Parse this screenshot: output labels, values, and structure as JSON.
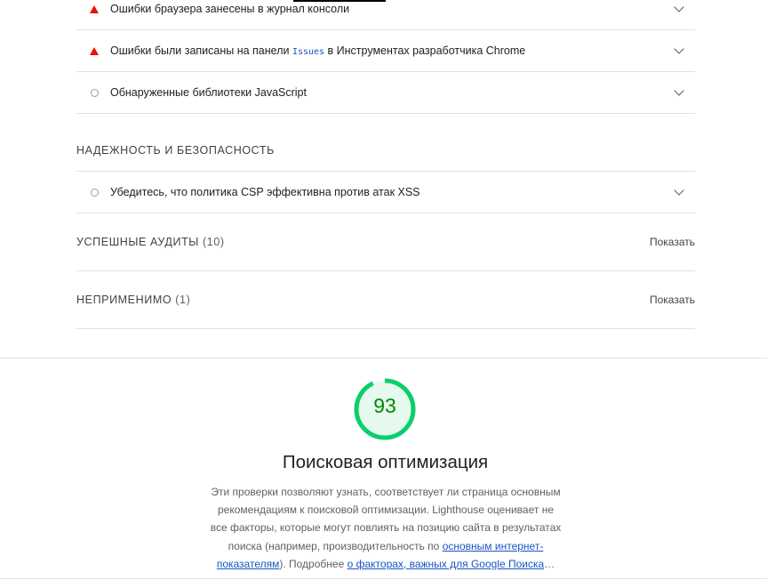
{
  "best_practices_audits": [
    {
      "type": "fail",
      "icon": "warning-triangle-icon",
      "title": "Ошибки браузера занесены в журнал консоли"
    },
    {
      "type": "fail",
      "icon": "warning-triangle-icon",
      "title_before": "Ошибки были записаны на панели ",
      "title_code": "Issues",
      "title_after": " в Инструментах разработчика Chrome"
    },
    {
      "type": "info",
      "icon": "neutral-circle-icon",
      "title": "Обнаруженные библиотеки JavaScript"
    }
  ],
  "trust_group": {
    "title": "НАДЕЖНОСТЬ И БЕЗОПАСНОСТЬ",
    "audits": [
      {
        "type": "info",
        "icon": "neutral-circle-icon",
        "title": "Убедитесь, что политика CSP эффективна против атак XSS"
      }
    ]
  },
  "passed_group": {
    "label": "УСПЕШНЫЕ АУДИТЫ",
    "count": "(10)",
    "show": "Показать"
  },
  "na_group": {
    "label": "НЕПРИМЕНИМО",
    "count": "(1)",
    "show": "Показать"
  },
  "seo_category": {
    "score": "93",
    "score_fraction": 0.93,
    "gauge_color": "#0cce6b",
    "score_text_color": "#008800",
    "title": "Поисковая оптимизация",
    "desc_line1": "Эти проверки позволяют узнать, соответствует ли страница основным",
    "desc_line2": "рекомендациям к поисковой оптимизации. Lighthouse оценивает не",
    "desc_line3": "все факторы, которые могут повлиять на позицию сайта в результатах",
    "desc_line4a": "поиска (например, производительность по ",
    "desc_link1a": "основным интернет-",
    "desc_link1b": "показателям",
    "desc_line5b": "). Подробнее ",
    "desc_link2": "о факторах, важных для Google Поиска",
    "desc_ellipsis": "…"
  }
}
